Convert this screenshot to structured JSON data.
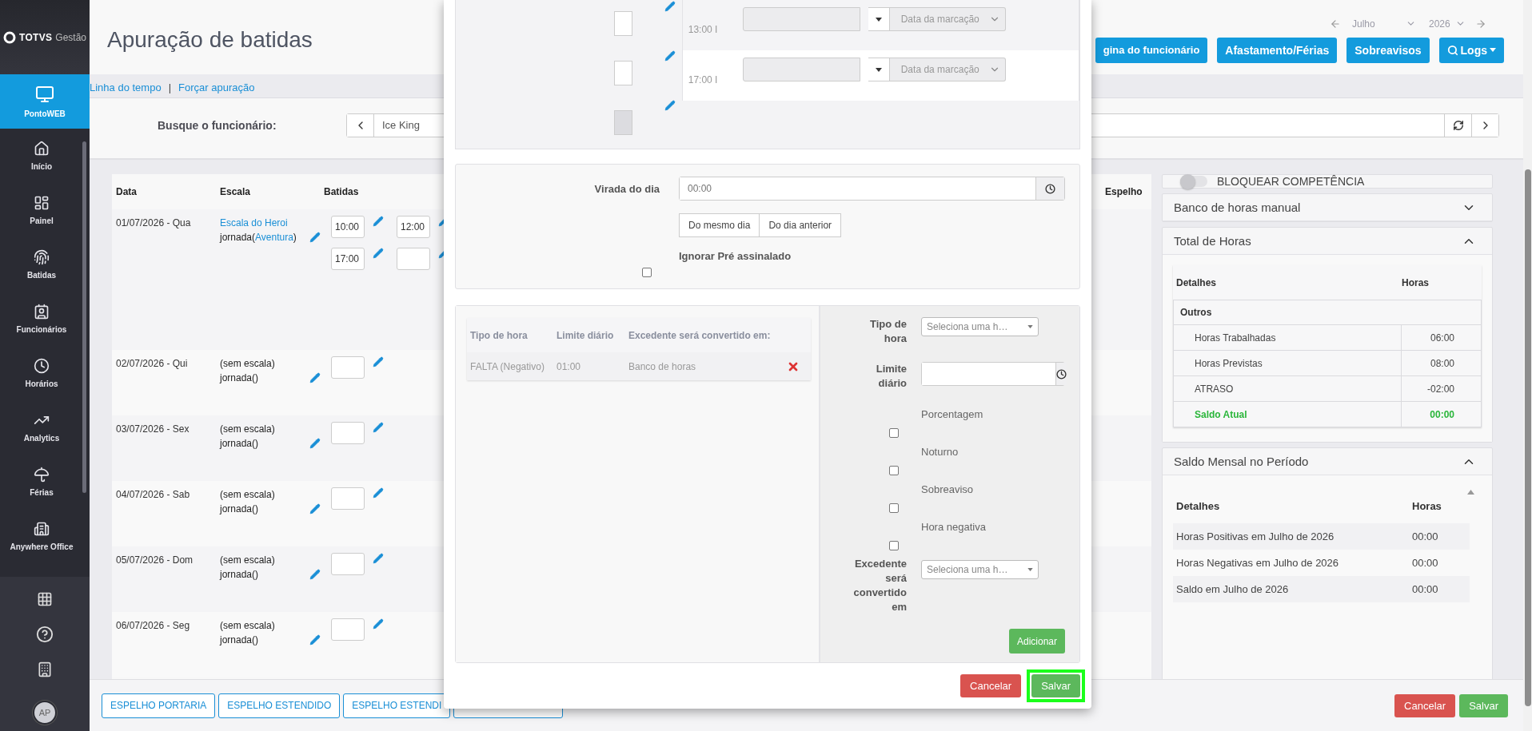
{
  "sidebar": {
    "logo": {
      "brand": "TOTVS",
      "product": "Gestão"
    },
    "items": [
      {
        "label": "PontoWEB",
        "selected": true
      },
      {
        "label": "Início",
        "selected": false
      },
      {
        "label": "Painel",
        "selected": false
      },
      {
        "label": "Batidas",
        "selected": false
      },
      {
        "label": "Funcionários",
        "selected": false
      },
      {
        "label": "Horários",
        "selected": false
      },
      {
        "label": "Analytics",
        "selected": false
      },
      {
        "label": "Férias",
        "selected": false
      },
      {
        "label": "Anywhere Office",
        "selected": false
      }
    ],
    "avatar": "AP"
  },
  "header": {
    "title": "Apuração de batidas",
    "month": "Julho",
    "year": "2026",
    "buttons": [
      {
        "label": "gina do funcionário",
        "kind": "plain"
      },
      {
        "label": "Afastamento/Férias",
        "kind": "plain"
      },
      {
        "label": "Sobreavisos",
        "kind": "plain"
      },
      {
        "label": "Logs",
        "kind": "search-menu"
      }
    ]
  },
  "links": {
    "items": [
      "Linha do tempo",
      "Forçar apuração"
    ],
    "separator": "|"
  },
  "search": {
    "label": "Busque o funcionário:",
    "value": "Ice King"
  },
  "table": {
    "columns": [
      "Data",
      "Escala",
      "Batidas",
      "Espelho"
    ],
    "rows": [
      {
        "date": "01/07/2026 - Qua",
        "schedule": {
          "text": "Escala do Heroi",
          "link": true
        },
        "journey": {
          "text": "jornada(",
          "link": "Aventura",
          "close": ")"
        },
        "punches": [
          {
            "value": "10:00"
          },
          {
            "value": "12:00"
          },
          {
            "value": "17:00"
          },
          {
            "kind": "empty"
          }
        ]
      },
      {
        "date": "02/07/2026 - Qui",
        "schedule": {
          "text": "(sem escala)",
          "link": false
        },
        "journey": {
          "text": "jornada()"
        },
        "punches": [
          {
            "kind": "empty"
          }
        ]
      },
      {
        "date": "03/07/2026 - Sex",
        "schedule": {
          "text": "(sem escala)",
          "link": false
        },
        "journey": {
          "text": "jornada()"
        },
        "punches": [
          {
            "kind": "empty"
          }
        ]
      },
      {
        "date": "04/07/2026 - Sab",
        "schedule": {
          "text": "(sem escala)",
          "link": false
        },
        "journey": {
          "text": "jornada()"
        },
        "punches": [
          {
            "kind": "empty"
          }
        ]
      },
      {
        "date": "05/07/2026 - Dom",
        "schedule": {
          "text": "(sem escala)",
          "link": false
        },
        "journey": {
          "text": "jornada()"
        },
        "punches": [
          {
            "kind": "empty"
          }
        ]
      },
      {
        "date": "06/07/2026 - Seg",
        "schedule": {
          "text": "(sem escala)",
          "link": false
        },
        "journey": {
          "text": "jornada()"
        },
        "punches": [
          {
            "kind": "empty"
          }
        ]
      }
    ]
  },
  "lock": {
    "label": "BLOQUEAR COMPETÊNCIA",
    "on": false
  },
  "panels": [
    {
      "title": "Banco de horas manual",
      "expanded": false
    },
    {
      "title": "Total de Horas",
      "expanded": true,
      "kind": "totals",
      "columns": [
        "Detalhes",
        "Horas"
      ],
      "group": "Outros",
      "rows": [
        {
          "label": "Horas Trabalhadas",
          "value": "06:00",
          "kind": "normal"
        },
        {
          "label": "Horas Previstas",
          "value": "08:00",
          "kind": "normal"
        },
        {
          "label": "ATRASO",
          "value": "-02:00",
          "kind": "normal"
        },
        {
          "label": "Saldo Atual",
          "value": "00:00",
          "kind": "total"
        }
      ]
    },
    {
      "title": "Saldo Mensal no Período",
      "expanded": true,
      "kind": "monthly",
      "columns": [
        "Detalhes",
        "Horas"
      ],
      "rows": [
        {
          "label": "Horas Positivas em Julho de 2026",
          "value": "00:00"
        },
        {
          "label": "Horas Negativas em Julho de 2026",
          "value": "00:00"
        },
        {
          "label": "Saldo em Julho de 2026",
          "value": "00:00"
        }
      ]
    }
  ],
  "footer": {
    "buttons": [
      {
        "label": "ESPELHO PORTARIA",
        "kind": "text"
      },
      {
        "label": "ESPELHO ESTENDIDO",
        "kind": "text"
      },
      {
        "label": "ESPELHO ESTENDI",
        "kind": "text"
      },
      {
        "kind": "covered"
      }
    ],
    "cancel": "Cancelar",
    "save": "Salvar"
  },
  "modal": {
    "entries": [
      {
        "disabled": false
      },
      {
        "disabled": false
      },
      {
        "disabled": true
      }
    ],
    "punch_rows": [
      {
        "time": "13:00",
        "mark": "I",
        "date_select": "Data da marcação"
      },
      {
        "time": "17:00",
        "mark": "I",
        "date_select": "Data da marcação"
      }
    ],
    "rollover": {
      "label": "Virada do dia",
      "placeholder": "00:00",
      "options": [
        {
          "label": "Do mesmo dia",
          "selected": false
        },
        {
          "label": "Do dia anterior",
          "selected": false
        }
      ]
    },
    "ignore": {
      "label": "Ignorar Pré assinalado",
      "checked": false
    },
    "rules": {
      "columns": [
        "Tipo de hora",
        "Limite diário",
        "Excedente será convertido em:"
      ],
      "rows": [
        {
          "type": "FALTA (Negativo)",
          "limit": "01:00",
          "convert": "Banco de horas"
        }
      ]
    },
    "form": {
      "type_label": "Tipo de hora",
      "type_placeholder": "Seleciona uma h…",
      "limit_label": "Limite diário",
      "flags": [
        {
          "label": "Porcentagem",
          "checked": false
        },
        {
          "label": "Noturno",
          "checked": false
        },
        {
          "label": "Sobreaviso",
          "checked": false
        },
        {
          "label": "Hora negativa",
          "checked": false
        }
      ],
      "convert_label": "Excedente será convertido em",
      "convert_placeholder": "Seleciona uma h…",
      "add": "Adicionar"
    },
    "cancel": "Cancelar",
    "save": "Salvar",
    "save_highlighted": true
  }
}
